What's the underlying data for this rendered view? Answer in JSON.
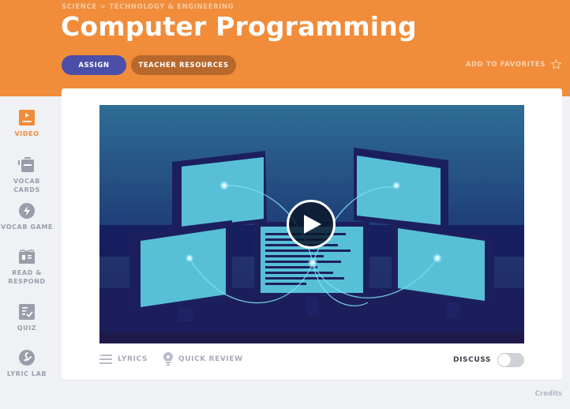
{
  "header": {
    "breadcrumb": [
      "SCIENCE",
      "TECHNOLOGY & ENGINEERING"
    ],
    "breadcrumb_separator": ">",
    "title": "Computer Programming",
    "assign_label": "ASSIGN",
    "teacher_resources_label": "TEACHER RESOURCES",
    "favorites_label": "ADD TO FAVORITES",
    "favorites_icon": "star-outline-icon"
  },
  "sidebar": {
    "items": [
      {
        "label": "VIDEO",
        "icon": "video-icon",
        "active": true
      },
      {
        "label": "VOCAB CARDS",
        "icon": "vocab-cards-icon",
        "active": false
      },
      {
        "label": "VOCAB GAME",
        "icon": "lightning-icon",
        "active": false
      },
      {
        "label": "READ & RESPOND",
        "icon": "book-icon",
        "active": false
      },
      {
        "label": "QUIZ",
        "icon": "quiz-check-icon",
        "active": false
      },
      {
        "label": "LYRIC LAB",
        "icon": "lyric-lab-icon",
        "active": false
      }
    ]
  },
  "video": {
    "play_icon": "play-icon",
    "description": "Illustration of five connected computer monitors"
  },
  "tools": {
    "lyrics_label": "LYRICS",
    "quick_review_label": "QUICK REVIEW",
    "discuss_label": "DISCUSS",
    "discuss_enabled": false
  },
  "footer": {
    "credits_label": "Credits"
  },
  "colors": {
    "header_orange": "#f08c3a",
    "assign_blue": "#4b4fa8",
    "teacher_brown": "#b8682c",
    "screen_cyan": "#58c0d6",
    "video_bg_top": "#2f6d95",
    "video_bg_bottom": "#1a1d55"
  }
}
